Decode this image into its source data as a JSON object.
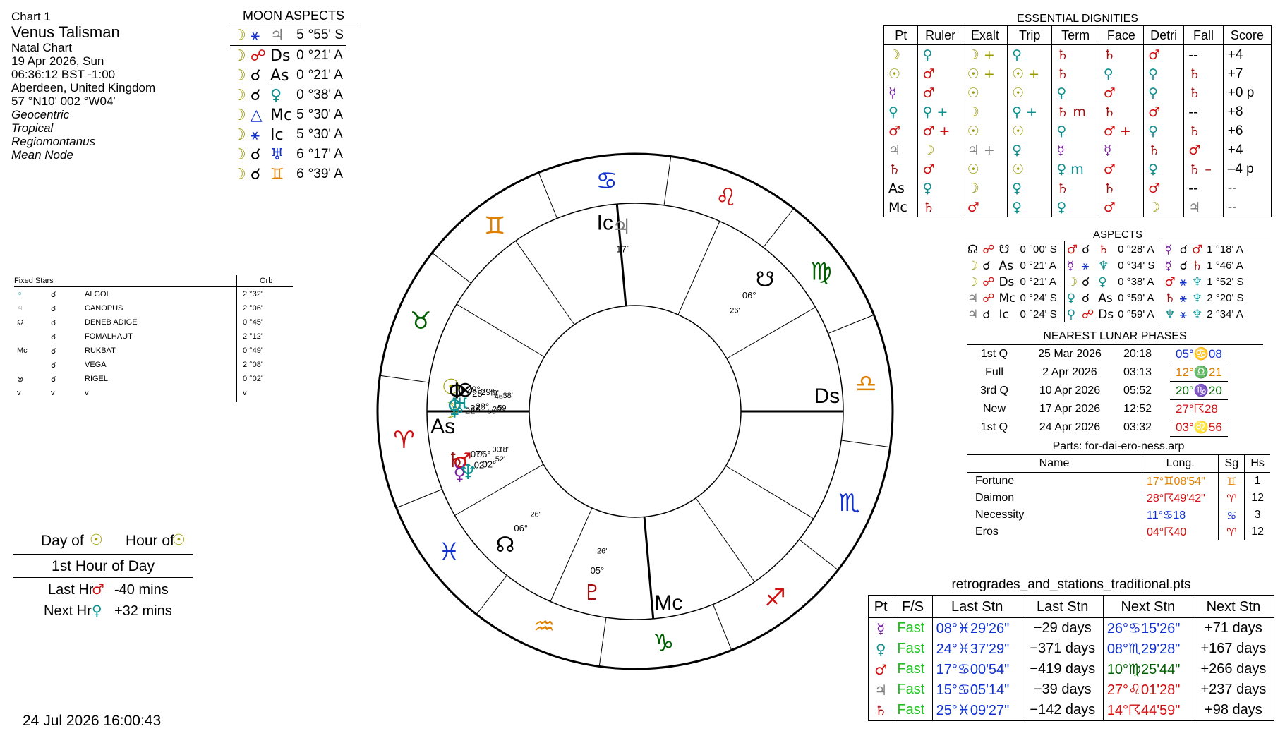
{
  "header": {
    "chart_no": "Chart 1",
    "name": "Venus Talisman",
    "type": "Natal Chart",
    "date": "19 Apr 2026, Sun",
    "time": "06:36:12  BST -1:00",
    "place": "Aberdeen, United Kingdom",
    "coords": "57 °N10' 002 °W04'",
    "zodiac1": "Geocentric",
    "zodiac2": "Tropical",
    "houses": "Regiomontanus",
    "node": "Mean Node"
  },
  "colors": {
    "moon": "#9a9a00",
    "sun": "#9a9a00",
    "mercury": "#7a1fa0",
    "venus": "#0f9090",
    "mars": "#d01010",
    "jupiter": "#808080",
    "saturn": "#a01010",
    "fire": "#d01010",
    "earth": "#006000",
    "air": "#e08000",
    "water": "#1030d0"
  },
  "moon_aspects": {
    "title": "MOON ASPECTS",
    "rows": [
      {
        "p1": "☽",
        "a": "⚹",
        "p2": "♃",
        "deg": "5",
        "min": "°55' S"
      },
      {
        "p1": "☽",
        "a": "☍",
        "p2": "Ds",
        "deg": "0",
        "min": "°21' A"
      },
      {
        "p1": "☽",
        "a": "☌",
        "p2": "As",
        "deg": "0",
        "min": "°21' A"
      },
      {
        "p1": "☽",
        "a": "☌",
        "p2": "♀",
        "deg": "0",
        "min": "°38' A"
      },
      {
        "p1": "☽",
        "a": "△",
        "p2": "Mc",
        "deg": "5",
        "min": "°30' A"
      },
      {
        "p1": "☽",
        "a": "⚹",
        "p2": "Ic",
        "deg": "5",
        "min": "°30' A"
      },
      {
        "p1": "☽",
        "a": "☌",
        "p2": "♅",
        "deg": "6",
        "min": "°17' A"
      },
      {
        "p1": "☽",
        "a": "☌",
        "p2": "♊",
        "deg": "6",
        "min": "°39' A"
      }
    ]
  },
  "fixed_stars": {
    "title": "Fixed Stars",
    "orb_label": "Orb",
    "rows": [
      {
        "p": "♀",
        "a": "☌",
        "star": "ALGOL",
        "orb": "2 °32'"
      },
      {
        "p": "♃",
        "a": "☌",
        "star": "CANOPUS",
        "orb": "2 °06'"
      },
      {
        "p": "☊",
        "a": "☌",
        "star": "DENEB ADIGE",
        "orb": "0 °45'"
      },
      {
        "p": "",
        "a": "☌",
        "star": "FOMALHAUT",
        "orb": "2 °12'"
      },
      {
        "p": "Mc",
        "a": "☌",
        "star": "RUKBAT",
        "orb": "0 °49'"
      },
      {
        "p": "",
        "a": "☌",
        "star": "VEGA",
        "orb": "2 °08'"
      },
      {
        "p": "⊗",
        "a": "☌",
        "star": "RIGEL",
        "orb": "0 °02'"
      },
      {
        "p": "v",
        "a": "v",
        "star": "v",
        "orb": "v"
      }
    ]
  },
  "hours": {
    "day_of": "Day of",
    "hour_of": "Hour of",
    "first_hour": "1st Hour of Day",
    "last_hr": "Last Hr",
    "last_val": "-40 mins",
    "next_hr": "Next Hr",
    "next_val": "+32 mins"
  },
  "timestamp": "24 Jul 2026  16:00:43",
  "essential": {
    "title": "ESSENTIAL DIGNITIES",
    "headers": [
      "Pt",
      "Ruler",
      "Exalt",
      "Trip",
      "Term",
      "Face",
      "Detri",
      "Fall",
      "Score"
    ],
    "rows": [
      {
        "pt": "☽",
        "ruler": "♀",
        "exalt": "☽ +",
        "trip": "♀",
        "term": "♄",
        "face": "♄",
        "detri": "♂",
        "fall": "--",
        "score": "+4"
      },
      {
        "pt": "☉",
        "ruler": "♂",
        "exalt": "☉ +",
        "trip": "☉ +",
        "term": "♄",
        "face": "♀",
        "detri": "♀",
        "fall": "♄",
        "score": "+7"
      },
      {
        "pt": "☿",
        "ruler": "♂",
        "exalt": "☉",
        "trip": "☉",
        "term": "♀",
        "face": "♂",
        "detri": "♀",
        "fall": "♄",
        "score": "+0  p"
      },
      {
        "pt": "♀",
        "ruler": "♀ +",
        "exalt": "☽",
        "trip": "♀ +",
        "term": "♄  m",
        "face": "♄",
        "detri": "♂",
        "fall": "--",
        "score": "+8"
      },
      {
        "pt": "♂",
        "ruler": "♂ +",
        "exalt": "☉",
        "trip": "☉",
        "term": "♀",
        "face": "♂ +",
        "detri": "♀",
        "fall": "♄",
        "score": "+6"
      },
      {
        "pt": "♃",
        "ruler": "☽",
        "exalt": "♃ +",
        "trip": "♀",
        "term": "☿",
        "face": "☿",
        "detri": "♄",
        "fall": "♂",
        "score": "+4"
      },
      {
        "pt": "♄",
        "ruler": "♂",
        "exalt": "☉",
        "trip": "☉",
        "term": "♀  m",
        "face": "♂",
        "detri": "♀",
        "fall": "♄  –",
        "score": "–4  p"
      },
      {
        "pt": "As",
        "ruler": "♀",
        "exalt": "☽",
        "trip": "♀",
        "term": "♄",
        "face": "♄",
        "detri": "♂",
        "fall": "--",
        "score": "--"
      },
      {
        "pt": "Mc",
        "ruler": "♄",
        "exalt": "♂",
        "trip": "♀",
        "term": "♀",
        "face": "♂",
        "detri": "☽",
        "fall": "♃",
        "score": "--"
      }
    ]
  },
  "aspects": {
    "title": "ASPECTS",
    "rows": [
      [
        {
          "p1": "☊",
          "a": "☍",
          "p2": "☋",
          "orb": "0 °00' S"
        },
        {
          "p1": "♂",
          "a": "☌",
          "p2": "♄",
          "orb": "0 °28' A"
        },
        {
          "p1": "☿",
          "a": "☌",
          "p2": "♂",
          "orb": "1 °18' A"
        }
      ],
      [
        {
          "p1": "☽",
          "a": "☌",
          "p2": "As",
          "orb": "0 °21' A"
        },
        {
          "p1": "☿",
          "a": "⚹",
          "p2": "♆",
          "orb": "0 °34' S"
        },
        {
          "p1": "☿",
          "a": "☌",
          "p2": "♄",
          "orb": "1 °46' A"
        }
      ],
      [
        {
          "p1": "☽",
          "a": "☍",
          "p2": "Ds",
          "orb": "0 °21' A"
        },
        {
          "p1": "☽",
          "a": "☌",
          "p2": "♀",
          "orb": "0 °38' A"
        },
        {
          "p1": "♂",
          "a": "⚹",
          "p2": "♆",
          "orb": "1 °52' S"
        }
      ],
      [
        {
          "p1": "♃",
          "a": "☍",
          "p2": "Mc",
          "orb": "0 °24' S"
        },
        {
          "p1": "♀",
          "a": "☌",
          "p2": "As",
          "orb": "0 °59' A"
        },
        {
          "p1": "♄",
          "a": "⚹",
          "p2": "♆",
          "orb": "2 °20' S"
        }
      ],
      [
        {
          "p1": "♃",
          "a": "☌",
          "p2": "Ic",
          "orb": "0 °24' S"
        },
        {
          "p1": "♀",
          "a": "☍",
          "p2": "Ds",
          "orb": "0 °59' A"
        },
        {
          "p1": "♆",
          "a": "⚹",
          "p2": "♆",
          "orb": "2 °34' A"
        }
      ]
    ]
  },
  "lunar_phases": {
    "title": "NEAREST LUNAR PHASES",
    "rows": [
      {
        "phase": "1st Q",
        "date": "25 Mar 2026",
        "time": "20:18",
        "pos": "05°♋08",
        "color": "#1030d0"
      },
      {
        "phase": "Full",
        "date": "2 Apr 2026",
        "time": "03:13",
        "pos": "12°♎21",
        "color": "#e08000"
      },
      {
        "phase": "3rd Q",
        "date": "10 Apr 2026",
        "time": "05:52",
        "pos": "20°♑20",
        "color": "#006000"
      },
      {
        "phase": "New",
        "date": "17 Apr 2026",
        "time": "12:52",
        "pos": "27°☈28",
        "color": "#d01010"
      },
      {
        "phase": "1st Q",
        "date": "24 Apr 2026",
        "time": "03:32",
        "pos": "03°♌56",
        "color": "#d01010"
      }
    ]
  },
  "parts": {
    "title": "Parts: for-dai-ero-ness.arp",
    "headers": [
      "Name",
      "Long.",
      "Sg",
      "Hs"
    ],
    "rows": [
      {
        "name": "Fortune",
        "long": "17°♊08'54\"",
        "sg": "♊",
        "hs": "1",
        "color": "#e08000"
      },
      {
        "name": "Daimon",
        "long": "28°☈49'42\"",
        "sg": "♈",
        "hs": "12",
        "color": "#d01010"
      },
      {
        "name": "Necessity",
        "long": "11°♋18",
        "sg": "♋",
        "hs": "3",
        "color": "#1030d0"
      },
      {
        "name": "Eros",
        "long": "04°☈40",
        "sg": "♈",
        "hs": "12",
        "color": "#d01010"
      }
    ]
  },
  "retro": {
    "title": "retrogrades_and_stations_traditional.pts",
    "headers": [
      "Pt",
      "F/S",
      "Last Stn",
      "Last Stn",
      "Next Stn",
      "Next Stn"
    ],
    "rows": [
      {
        "pt": "☿",
        "fs": "Fast",
        "ls": "08°♓29'26\"",
        "ld": "−29 days",
        "ns": "26°♋15'26\"",
        "nd": "+71 days",
        "lc": "#1030d0",
        "nc": "#1030d0",
        "pc": "#7a1fa0"
      },
      {
        "pt": "♀",
        "fs": "Fast",
        "ls": "24°♓37'29\"",
        "ld": "−371 days",
        "ns": "08°♏29'28\"",
        "nd": "+167 days",
        "lc": "#1030d0",
        "nc": "#1030d0",
        "pc": "#0f9090"
      },
      {
        "pt": "♂",
        "fs": "Fast",
        "ls": "17°♋00'54\"",
        "ld": "−419 days",
        "ns": "10°♍25'44\"",
        "nd": "+266 days",
        "lc": "#1030d0",
        "nc": "#006000",
        "pc": "#d01010"
      },
      {
        "pt": "♃",
        "fs": "Fast",
        "ls": "15°♋05'14\"",
        "ld": "−39 days",
        "ns": "27°♌01'28\"",
        "nd": "+237 days",
        "lc": "#1030d0",
        "nc": "#d01010",
        "pc": "#808080"
      },
      {
        "pt": "♄",
        "fs": "Fast",
        "ls": "25°♓09'27\"",
        "ld": "−142 days",
        "ns": "14°☈44'59\"",
        "nd": "+98 days",
        "lc": "#1030d0",
        "nc": "#d01010",
        "pc": "#a01010"
      }
    ]
  },
  "wheel": {
    "asc_deg": 22,
    "signs": [
      {
        "glyph": "♈",
        "start": 0,
        "color": "#d01010"
      },
      {
        "glyph": "♉",
        "start": 30,
        "color": "#006000"
      },
      {
        "glyph": "♊",
        "start": 60,
        "color": "#e08000"
      },
      {
        "glyph": "♋",
        "start": 90,
        "color": "#1030d0"
      },
      {
        "glyph": "♌",
        "start": 120,
        "color": "#d01010"
      },
      {
        "glyph": "♍",
        "start": 150,
        "color": "#006000"
      },
      {
        "glyph": "♎",
        "start": 180,
        "color": "#e08000"
      },
      {
        "glyph": "♏",
        "start": 210,
        "color": "#1030d0"
      },
      {
        "glyph": "♐",
        "start": 240,
        "color": "#d01010"
      },
      {
        "glyph": "♑",
        "start": 270,
        "color": "#006000"
      },
      {
        "glyph": "♒",
        "start": 300,
        "color": "#e08000"
      },
      {
        "glyph": "♓",
        "start": 330,
        "color": "#1030d0"
      }
    ],
    "cusps": [
      {
        "label": "As",
        "lon": 22
      },
      {
        "label": "",
        "lon": 53
      },
      {
        "label": "",
        "lon": 77
      },
      {
        "label": "Ic",
        "lon": 107
      },
      {
        "label": "",
        "lon": 136
      },
      {
        "label": "",
        "lon": 172
      },
      {
        "label": "Ds",
        "lon": 202
      },
      {
        "label": "",
        "lon": 233
      },
      {
        "label": "",
        "lon": 257
      },
      {
        "label": "Mc",
        "lon": 287
      },
      {
        "label": "",
        "lon": 316
      },
      {
        "label": "",
        "lon": 352
      }
    ],
    "planets": [
      {
        "glyph": "☽",
        "lon": 22.4,
        "deg": "22°",
        "min": "59'",
        "color": "#9a9a00",
        "r": 0.78
      },
      {
        "glyph": "♀",
        "lon": 23.3,
        "deg": "23°",
        "min": "20'",
        "color": "#0f9090",
        "r": 0.73
      },
      {
        "glyph": "♅",
        "lon": 23.98,
        "deg": "23°",
        "min": "59'",
        "color": "#0f9090",
        "r": 0.68
      },
      {
        "glyph": "⊗",
        "lon": 29.6,
        "deg": "29°",
        "min": "38'",
        "color": "#000000",
        "r": 0.64
      },
      {
        "glyph": "☉",
        "lon": 29.8,
        "deg": "29°",
        "min": "49'",
        "color": "#9a9a00",
        "r": 0.78
      },
      {
        "glyph": "Φ",
        "lon": 28.7,
        "deg": "28°",
        "min": "46'",
        "color": "#000000",
        "r": 0.72
      },
      {
        "glyph": "♄",
        "lon": 7.0,
        "deg": "07°",
        "min": "00'",
        "color": "#a01010",
        "r": 0.78
      },
      {
        "glyph": "♂",
        "lon": 6.3,
        "deg": "06°",
        "min": "18'",
        "color": "#d01010",
        "r": 0.72
      },
      {
        "glyph": "☿",
        "lon": 2.9,
        "deg": "02°",
        "min": "52'",
        "color": "#7a1fa0",
        "r": 0.78
      },
      {
        "glyph": "♆",
        "lon": 2.2,
        "deg": "02°",
        "min": "",
        "color": "#0f9090",
        "r": 0.7
      },
      {
        "glyph": "☊",
        "lon": 336.4,
        "deg": "06°",
        "min": "26'",
        "color": "#000000",
        "r": 0.78
      },
      {
        "glyph": "♇",
        "lon": 305.4,
        "deg": "05°",
        "min": "26'",
        "color": "#a01010",
        "r": 0.78
      },
      {
        "glyph": "♃",
        "lon": 107.8,
        "deg": "17°",
        "min": "",
        "color": "#808080",
        "r": 0.78
      },
      {
        "glyph": "☋",
        "lon": 156.4,
        "deg": "06°",
        "min": "26'",
        "color": "#000000",
        "r": 0.78
      }
    ]
  }
}
